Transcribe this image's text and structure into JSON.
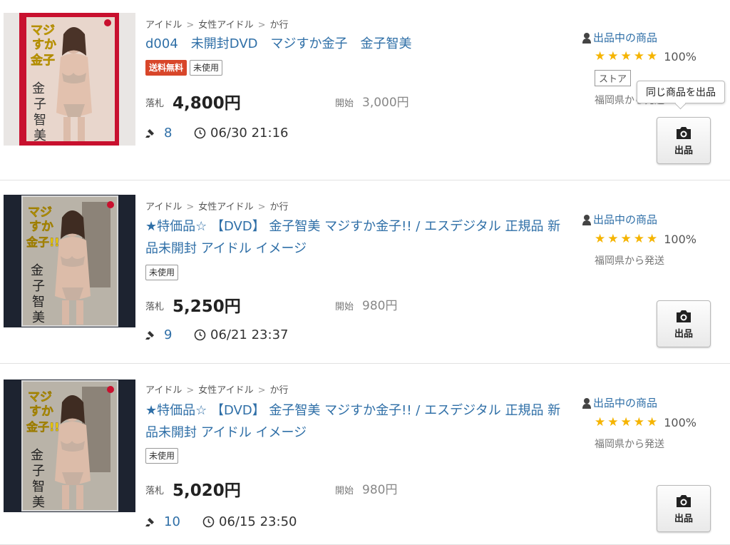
{
  "listings": [
    {
      "crumbs": [
        "アイドル",
        "女性アイドル",
        "か行"
      ],
      "title": "d004　未開封DVD　マジすか金子　金子智美",
      "badges": [
        "送料無料",
        "未使用"
      ],
      "price_label": "落札",
      "price": "4,800円",
      "start_label": "開始",
      "start": "3,000円",
      "bids": "8",
      "time": "06/30 21:16",
      "seller": "出品中の商品",
      "stars": "★★★★★",
      "rating": "100%",
      "store_badge": "ストア",
      "ship": "福岡県から発送",
      "button_label": "出品",
      "tooltip": "同じ商品を出品",
      "cover_text": [
        "マジ",
        "すか",
        "金子",
        "金",
        "子",
        "智",
        "美"
      ]
    },
    {
      "crumbs": [
        "アイドル",
        "女性アイドル",
        "か行"
      ],
      "title": "★特価品☆ 【DVD】 金子智美 マジすか金子!! / エスデジタル 正規品 新品未開封 アイドル イメージ",
      "badges": [
        "未使用"
      ],
      "price_label": "落札",
      "price": "5,250円",
      "start_label": "開始",
      "start": "980円",
      "bids": "9",
      "time": "06/21 23:37",
      "seller": "出品中の商品",
      "stars": "★★★★★",
      "rating": "100%",
      "ship": "福岡県から発送",
      "button_label": "出品",
      "cover_text": [
        "マジ",
        "すか",
        "金子!!",
        "金",
        "子",
        "智",
        "美"
      ]
    },
    {
      "crumbs": [
        "アイドル",
        "女性アイドル",
        "か行"
      ],
      "title": "★特価品☆ 【DVD】 金子智美 マジすか金子!! / エスデジタル 正規品 新品未開封 アイドル イメージ",
      "badges": [
        "未使用"
      ],
      "price_label": "落札",
      "price": "5,020円",
      "start_label": "開始",
      "start": "980円",
      "bids": "10",
      "time": "06/15 23:50",
      "seller": "出品中の商品",
      "stars": "★★★★★",
      "rating": "100%",
      "ship": "福岡県から発送",
      "button_label": "出品",
      "cover_text": [
        "マジ",
        "すか",
        "金子!!",
        "金",
        "子",
        "智",
        "美"
      ]
    }
  ],
  "colors": {
    "link": "#2f6fa7",
    "star": "#f5b400",
    "free_shipping": "#d8462a",
    "cover_red": "#c8102e",
    "cover_yellow": "#f2d100"
  }
}
